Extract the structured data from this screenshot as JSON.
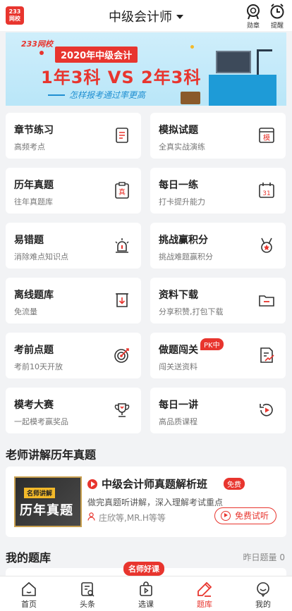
{
  "header": {
    "logo_text": "233网校",
    "title": "中级会计师",
    "medal_label": "勋章",
    "reminder_label": "提醒"
  },
  "banner": {
    "brand": "233网校",
    "line1": "2020年中级会计",
    "line2": "1年3科 VS 2年3科",
    "line3": "怎样报考通过率更高"
  },
  "grid": [
    {
      "title": "章节练习",
      "sub": "高频考点",
      "icon": "list-doc-icon"
    },
    {
      "title": "模拟试题",
      "sub": "全真实战演练",
      "icon": "mock-exam-icon",
      "icon_text": "模"
    },
    {
      "title": "历年真题",
      "sub": "往年真题库",
      "icon": "clipboard-icon",
      "icon_text": "真"
    },
    {
      "title": "每日一练",
      "sub": "打卡提升能力",
      "icon": "calendar-icon",
      "icon_text": "31"
    },
    {
      "title": "易错题",
      "sub": "消除难点知识点",
      "icon": "alarm-light-icon"
    },
    {
      "title": "挑战赢积分",
      "sub": "挑战难题赢积分",
      "icon": "medal-icon"
    },
    {
      "title": "离线题库",
      "sub": "免流量",
      "icon": "offline-download-icon"
    },
    {
      "title": "资料下载",
      "sub": "分享积赞,打包下载",
      "icon": "folder-icon"
    },
    {
      "title": "考前点题",
      "sub": "考前10天开放",
      "icon": "target-icon"
    },
    {
      "title": "做题闯关",
      "sub": "闯关送资料",
      "icon": "doc-chart-icon",
      "badge": "PK中"
    },
    {
      "title": "模考大赛",
      "sub": "一起模考赢奖品",
      "icon": "trophy-icon"
    },
    {
      "title": "每日一讲",
      "sub": "高品质课程",
      "icon": "replay-play-icon"
    }
  ],
  "teacher_section": {
    "title": "老师讲解历年真题",
    "course": {
      "thumb_tag": "名师讲解",
      "thumb_text": "历年真题",
      "name": "中级会计师真题解析班",
      "free_tag": "免费",
      "desc": "做完真题听讲解，深入理解考试重点",
      "teachers": "庄欣等,MR.H等等",
      "try_label": "免费试听"
    }
  },
  "my_bank": {
    "title": "我的题库",
    "right": "昨日题量 0"
  },
  "promo_badge": "名师好课",
  "tabs": [
    {
      "label": "首页",
      "icon": "home-icon"
    },
    {
      "label": "头条",
      "icon": "news-icon"
    },
    {
      "label": "选课",
      "icon": "course-bag-icon"
    },
    {
      "label": "题库",
      "icon": "pen-icon",
      "active": true
    },
    {
      "label": "我的",
      "icon": "profile-icon"
    }
  ],
  "colors": {
    "accent": "#e8352e",
    "background": "#f2f3f5",
    "card": "#ffffff",
    "banner_blue": "#1f8fd1"
  }
}
